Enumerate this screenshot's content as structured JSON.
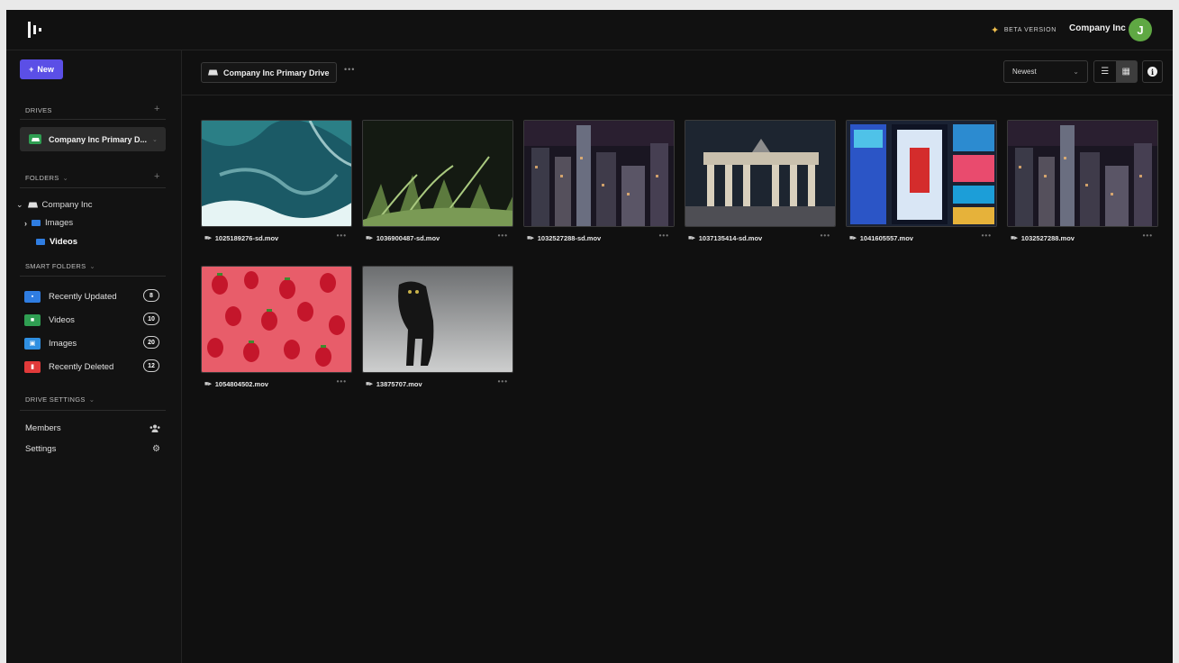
{
  "topbar": {
    "beta_label": "BETA VERSION",
    "company_name": "Company Inc",
    "avatar_initial": "J",
    "avatar_color": "#5fa843"
  },
  "sidebar": {
    "new_button": "New",
    "drives_heading": "DRIVES",
    "drive_name": "Company Inc Primary D...",
    "folders_heading": "FOLDERS",
    "tree": {
      "root": "Company Inc",
      "children": [
        "Images",
        "Videos"
      ]
    },
    "smart_folders_heading": "SMART FOLDERS",
    "smart_folders": [
      {
        "label": "Recently Updated",
        "count": "8",
        "color": "#2f7de1",
        "icon": "folder-icon"
      },
      {
        "label": "Videos",
        "count": "10",
        "color": "#2f9e52",
        "icon": "video-folder-icon"
      },
      {
        "label": "Images",
        "count": "20",
        "color": "#2f8fe1",
        "icon": "image-folder-icon"
      },
      {
        "label": "Recently Deleted",
        "count": "12",
        "color": "#e13a3a",
        "icon": "trash-folder-icon"
      }
    ],
    "drive_settings_heading": "DRIVE SETTINGS",
    "settings_rows": [
      {
        "label": "Members",
        "icon": "members-icon"
      },
      {
        "label": "Settings",
        "icon": "gear-icon"
      }
    ]
  },
  "toolbar": {
    "breadcrumb": "Company Inc Primary Drive",
    "sort_value": "Newest"
  },
  "files": [
    {
      "name": "1025189276-sd.mov",
      "scene": "ocean"
    },
    {
      "name": "1036900487-sd.mov",
      "scene": "grass"
    },
    {
      "name": "1032527288-sd.mov",
      "scene": "city"
    },
    {
      "name": "1037135414-sd.mov",
      "scene": "gate"
    },
    {
      "name": "1041605557.mov",
      "scene": "billboards"
    },
    {
      "name": "1032527288.mov",
      "scene": "city"
    },
    {
      "name": "1054804502.mov",
      "scene": "strawberries"
    },
    {
      "name": "13875707.mov",
      "scene": "panther"
    }
  ],
  "colors": {
    "accent": "#5b4fe6",
    "beta_star": "#f2c14e",
    "drive_green": "#2f9e52"
  }
}
